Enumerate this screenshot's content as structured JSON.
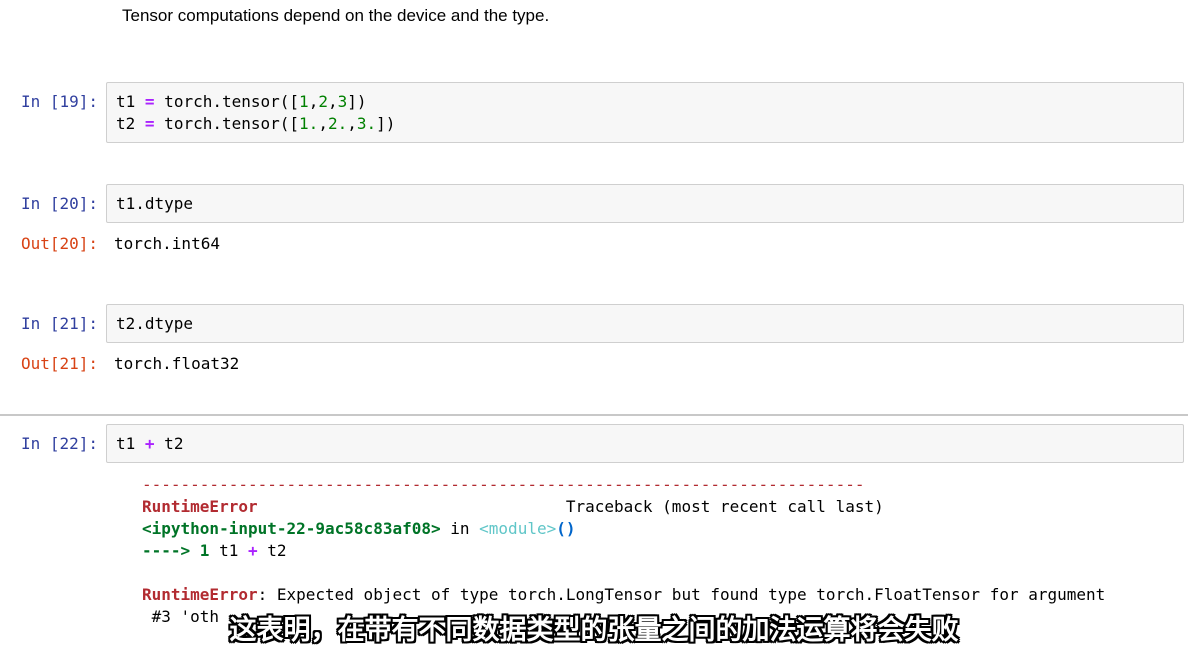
{
  "markdown": {
    "text": "Tensor computations depend on the device and the type."
  },
  "cells": {
    "c19": {
      "in_prompt": "In [19]:",
      "line1": {
        "a": "t1 ",
        "op": "=",
        "b": " torch.tensor([",
        "n1": "1",
        "c1": ",",
        "n2": "2",
        "c2": ",",
        "n3": "3",
        "e": "])"
      },
      "line2": {
        "a": "t2 ",
        "op": "=",
        "b": " torch.tensor([",
        "n1": "1.",
        "c1": ",",
        "n2": "2.",
        "c2": ",",
        "n3": "3.",
        "e": "])"
      }
    },
    "c20": {
      "in_prompt": "In [20]:",
      "code": "t1.dtype",
      "out_prompt": "Out[20]:",
      "output": "torch.int64"
    },
    "c21": {
      "in_prompt": "In [21]:",
      "code": "t2.dtype",
      "out_prompt": "Out[21]:",
      "output": "torch.float32"
    },
    "c22": {
      "in_prompt": "In [22]:",
      "code_a": "t1 ",
      "code_op": "+",
      "code_b": " t2",
      "error": {
        "dashes": "---------------------------------------------------------------------------",
        "err_name": "RuntimeError",
        "traceback_label": "                                Traceback (most recent call last)",
        "input_ref": "<ipython-input-22-9ac58c83af08>",
        "in_word": " in ",
        "module": "<module>",
        "parens": "()",
        "arrow": "----> 1 ",
        "arrow_code_a": "t1 ",
        "arrow_code_op": "+",
        "arrow_code_b": " t2",
        "err_name2": "RuntimeError",
        "message": ": Expected object of type torch.LongTensor but found type torch.FloatTensor for argument",
        "message2": " #3 'oth"
      }
    }
  },
  "subtitle": "这表明，在带有不同数据类型的张量之间的加法运算将会失败"
}
